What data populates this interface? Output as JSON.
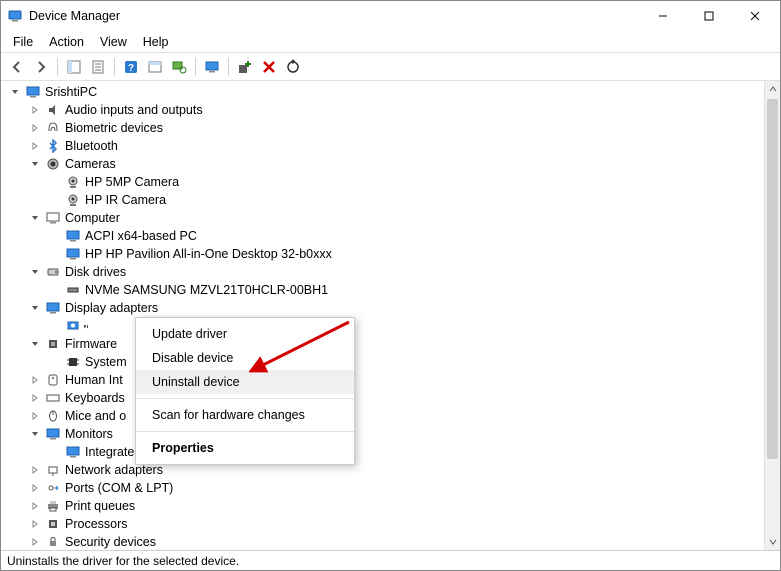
{
  "window": {
    "title": "Device Manager"
  },
  "menubar": [
    "File",
    "Action",
    "View",
    "Help"
  ],
  "toolbar_icons": [
    "nav-back",
    "nav-forward",
    "sep",
    "console-tree",
    "properties",
    "sep",
    "help",
    "show-hidden",
    "scan",
    "sep",
    "monitor",
    "sep",
    "add-driver",
    "remove",
    "update"
  ],
  "tree": {
    "root": "SrishtiPC",
    "nodes": [
      {
        "label": "Audio inputs and outputs",
        "expanded": false,
        "icon": "audio"
      },
      {
        "label": "Biometric devices",
        "expanded": false,
        "icon": "biometric"
      },
      {
        "label": "Bluetooth",
        "expanded": false,
        "icon": "bluetooth"
      },
      {
        "label": "Cameras",
        "expanded": true,
        "icon": "camera",
        "children": [
          {
            "label": "HP 5MP Camera",
            "icon": "webcam"
          },
          {
            "label": "HP IR Camera",
            "icon": "webcam"
          }
        ]
      },
      {
        "label": "Computer",
        "expanded": true,
        "icon": "computer",
        "children": [
          {
            "label": "ACPI x64-based PC",
            "icon": "monitor"
          },
          {
            "label": "HP HP Pavilion All-in-One Desktop 32-b0xxx",
            "icon": "monitor"
          }
        ]
      },
      {
        "label": "Disk drives",
        "expanded": true,
        "icon": "disk",
        "children": [
          {
            "label": "NVMe SAMSUNG MZVL21T0HCLR-00BH1",
            "icon": "drive"
          }
        ]
      },
      {
        "label": "Display adapters",
        "expanded": true,
        "icon": "display",
        "children": [
          {
            "label": "",
            "icon": "gpu",
            "selected": true
          }
        ]
      },
      {
        "label": "Firmware",
        "expanded": true,
        "icon": "firmware",
        "children": [
          {
            "label": "System",
            "icon": "chip",
            "truncated": true
          }
        ]
      },
      {
        "label": "Human Int",
        "expanded": false,
        "icon": "hid",
        "truncated": true
      },
      {
        "label": "Keyboards",
        "expanded": false,
        "icon": "keyboard",
        "truncated": true
      },
      {
        "label": "Mice and o",
        "expanded": false,
        "icon": "mouse",
        "truncated": true
      },
      {
        "label": "Monitors",
        "expanded": true,
        "icon": "monitors",
        "children": [
          {
            "label": "Integrated Monitor (HP All-in-One)",
            "icon": "monitor",
            "truncated_overlay": true
          }
        ]
      },
      {
        "label": "Network adapters",
        "expanded": false,
        "icon": "network"
      },
      {
        "label": "Ports (COM & LPT)",
        "expanded": false,
        "icon": "ports"
      },
      {
        "label": "Print queues",
        "expanded": false,
        "icon": "printer"
      },
      {
        "label": "Processors",
        "expanded": false,
        "icon": "cpu"
      },
      {
        "label": "Security devices",
        "expanded": false,
        "icon": "security"
      }
    ]
  },
  "context_menu": {
    "items": [
      {
        "label": "Update driver",
        "type": "item"
      },
      {
        "label": "Disable device",
        "type": "item"
      },
      {
        "label": "Uninstall device",
        "type": "item",
        "hover": true
      },
      {
        "type": "sep"
      },
      {
        "label": "Scan for hardware changes",
        "type": "item"
      },
      {
        "type": "sep"
      },
      {
        "label": "Properties",
        "type": "item",
        "bold": true
      }
    ]
  },
  "statusbar": "Uninstalls the driver for the selected device."
}
